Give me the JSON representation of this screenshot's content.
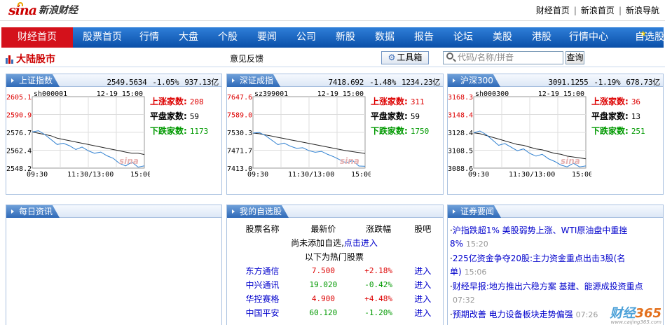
{
  "header": {
    "logo_sina": "sina",
    "logo_text": "新浪财经",
    "links": [
      "财经首页",
      "新浪首页",
      "新浪导航"
    ]
  },
  "nav": {
    "items": [
      "财经首页",
      "股票首页",
      "行情",
      "大盘",
      "个股",
      "要闻",
      "公司",
      "新股",
      "数据",
      "报告",
      "论坛",
      "美股",
      "港股",
      "行情中心",
      "自选股"
    ],
    "active": 0
  },
  "subbar": {
    "market": "大陆股市",
    "feedback": "意见反馈",
    "toolbox": "工具箱",
    "search_placeholder": "代码/名称/拼音",
    "query": "查询"
  },
  "index_panels": [
    {
      "name": "上证指数",
      "value": "2549.5634",
      "change": "-1.05%",
      "amount": "937.13亿",
      "code": "sh000001",
      "datetime": "12-19 15:00",
      "y_labels": [
        "2605.1",
        "2590.9",
        "2576.7",
        "2562.4",
        "2548.2"
      ],
      "x_labels": [
        "09:30",
        "11:30/13:00",
        "15:00"
      ],
      "up_label": "上涨家数:",
      "up": "208",
      "flat_label": "平盘家数:",
      "flat": "59",
      "down_label": "下跌家数:",
      "down": "1173",
      "price": [
        2577,
        2578,
        2575,
        2571,
        2567,
        2568,
        2566,
        2563,
        2565,
        2562,
        2560,
        2561,
        2558,
        2556,
        2552,
        2550,
        2553,
        2549,
        2550
      ],
      "avg": [
        2577,
        2576,
        2575,
        2574,
        2572,
        2571,
        2570,
        2569,
        2568,
        2567,
        2566,
        2565,
        2564,
        2563,
        2562,
        2561,
        2560,
        2560,
        2559
      ],
      "ylim": [
        2548.2,
        2605.1
      ]
    },
    {
      "name": "深证成指",
      "value": "7418.692",
      "change": "-1.48%",
      "amount": "1234.23亿",
      "code": "sz399001",
      "datetime": "12-19 15:00",
      "y_labels": [
        "7647.6",
        "7589.0",
        "7530.3",
        "7471.7",
        "7413.0"
      ],
      "x_labels": [
        "09:30",
        "11:30/13:00",
        "15:00"
      ],
      "up_label": "上涨家数:",
      "up": "311",
      "flat_label": "平盘家数:",
      "flat": "59",
      "down_label": "下跌家数:",
      "down": "1750",
      "price": [
        7528,
        7530,
        7520,
        7505,
        7490,
        7495,
        7485,
        7478,
        7480,
        7470,
        7465,
        7468,
        7458,
        7450,
        7440,
        7430,
        7438,
        7420,
        7419
      ],
      "avg": [
        7528,
        7526,
        7522,
        7518,
        7514,
        7510,
        7506,
        7502,
        7498,
        7494,
        7490,
        7486,
        7482,
        7478,
        7474,
        7470,
        7467,
        7464,
        7461
      ],
      "ylim": [
        7413.0,
        7647.6
      ]
    },
    {
      "name": "沪深300",
      "value": "3091.1255",
      "change": "-1.19%",
      "amount": "678.73亿",
      "code": "sh000300",
      "datetime": "12-19 15:00",
      "y_labels": [
        "3168.3",
        "3148.4",
        "3128.4",
        "3108.5",
        "3088.6"
      ],
      "x_labels": [
        "09:30",
        "11:30/13:00",
        "15:00"
      ],
      "up_label": "上涨家数:",
      "up": "36",
      "flat_label": "平盘家数:",
      "flat": "13",
      "down_label": "下跌家数:",
      "down": "251",
      "price": [
        3128,
        3130,
        3126,
        3120,
        3114,
        3116,
        3112,
        3108,
        3110,
        3105,
        3102,
        3104,
        3099,
        3096,
        3092,
        3090,
        3094,
        3090,
        3091
      ],
      "avg": [
        3128,
        3127,
        3125,
        3123,
        3121,
        3119,
        3117,
        3115,
        3114,
        3112,
        3110,
        3109,
        3107,
        3105,
        3104,
        3102,
        3101,
        3100,
        3099
      ],
      "ylim": [
        3088.6,
        3168.3
      ]
    }
  ],
  "daily": {
    "title": "每日资讯"
  },
  "watchlist": {
    "title": "我的自选股",
    "headers": [
      "股票名称",
      "最新价",
      "涨跌幅",
      "股吧"
    ],
    "empty_text": "尚未添加自选,",
    "empty_link": "点击进入",
    "hot_text": "以下为热门股票",
    "rows": [
      {
        "name": "东方通信",
        "price": "7.500",
        "change": "+2.18%",
        "bar": "进入",
        "dir": "up"
      },
      {
        "name": "中兴通讯",
        "price": "19.020",
        "change": "-0.42%",
        "bar": "进入",
        "dir": "down"
      },
      {
        "name": "华控赛格",
        "price": "4.900",
        "change": "+4.48%",
        "bar": "进入",
        "dir": "up"
      },
      {
        "name": "中国平安",
        "price": "60.120",
        "change": "-1.20%",
        "bar": "进入",
        "dir": "down"
      }
    ]
  },
  "news": {
    "title": "证券要闻",
    "items": [
      {
        "text": "沪指跌超1% 美股弱势上涨、WTI原油盘中重挫8%",
        "time": "15:20"
      },
      {
        "text": "225亿资金争夺20股:主力资金重点出击3股(名单)",
        "time": "15:06"
      },
      {
        "text": "财经早报:地方推出六稳方案 基建、能源成投资重点",
        "time": "07:32"
      },
      {
        "text": "预期改善 电力设备板块走势偏强",
        "time": "07:26"
      }
    ]
  },
  "watermark": {
    "a": "财经",
    "b": "365",
    "sub": "www.caijing365.com"
  },
  "colors": {
    "up": "#dd0000",
    "down": "#009900",
    "nav": "#0a4fa8",
    "active": "#d4111b",
    "price_line": "#2d7fd0",
    "avg_line": "#222222"
  }
}
